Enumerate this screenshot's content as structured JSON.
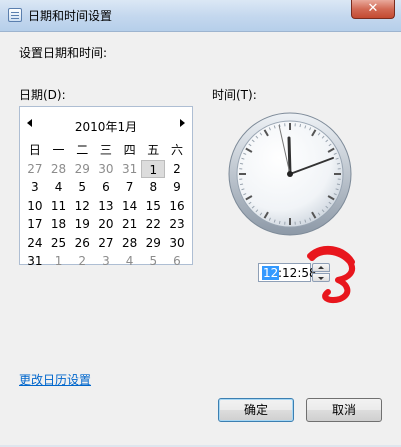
{
  "window": {
    "title": "日期和时间设置",
    "close_label": "✕"
  },
  "heading": "设置日期和时间:",
  "date_label": "日期(D):",
  "time_label": "时间(T):",
  "calendar": {
    "month_title": "2010年1月",
    "weekdays": [
      "日",
      "一",
      "二",
      "三",
      "四",
      "五",
      "六"
    ],
    "weeks": [
      [
        {
          "d": "27",
          "cur": false
        },
        {
          "d": "28",
          "cur": false
        },
        {
          "d": "29",
          "cur": false
        },
        {
          "d": "30",
          "cur": false
        },
        {
          "d": "31",
          "cur": false
        },
        {
          "d": "1",
          "cur": true,
          "selected": true
        },
        {
          "d": "2",
          "cur": true
        }
      ],
      [
        {
          "d": "3",
          "cur": true
        },
        {
          "d": "4",
          "cur": true
        },
        {
          "d": "5",
          "cur": true
        },
        {
          "d": "6",
          "cur": true
        },
        {
          "d": "7",
          "cur": true
        },
        {
          "d": "8",
          "cur": true
        },
        {
          "d": "9",
          "cur": true
        }
      ],
      [
        {
          "d": "10",
          "cur": true
        },
        {
          "d": "11",
          "cur": true
        },
        {
          "d": "12",
          "cur": true
        },
        {
          "d": "13",
          "cur": true
        },
        {
          "d": "14",
          "cur": true
        },
        {
          "d": "15",
          "cur": true
        },
        {
          "d": "16",
          "cur": true
        }
      ],
      [
        {
          "d": "17",
          "cur": true
        },
        {
          "d": "18",
          "cur": true
        },
        {
          "d": "19",
          "cur": true
        },
        {
          "d": "20",
          "cur": true
        },
        {
          "d": "21",
          "cur": true
        },
        {
          "d": "22",
          "cur": true
        },
        {
          "d": "23",
          "cur": true
        }
      ],
      [
        {
          "d": "24",
          "cur": true
        },
        {
          "d": "25",
          "cur": true
        },
        {
          "d": "26",
          "cur": true
        },
        {
          "d": "27",
          "cur": true
        },
        {
          "d": "28",
          "cur": true
        },
        {
          "d": "29",
          "cur": true
        },
        {
          "d": "30",
          "cur": true
        }
      ],
      [
        {
          "d": "31",
          "cur": true
        },
        {
          "d": "1",
          "cur": false
        },
        {
          "d": "2",
          "cur": false
        },
        {
          "d": "3",
          "cur": false
        },
        {
          "d": "4",
          "cur": false
        },
        {
          "d": "5",
          "cur": false
        },
        {
          "d": "6",
          "cur": false
        }
      ]
    ]
  },
  "time": {
    "hour_selected": "12",
    "rest": ":12:58"
  },
  "change_calendar_link": "更改日历设置",
  "buttons": {
    "ok": "确定",
    "cancel": "取消"
  },
  "colors": {
    "selection": "#3399ff",
    "link": "#0066cc",
    "annotation_red": "#e8161d"
  },
  "icons": [
    "app-icon",
    "close-icon",
    "prev-month-icon",
    "next-month-icon",
    "spin-up-icon",
    "spin-down-icon"
  ]
}
